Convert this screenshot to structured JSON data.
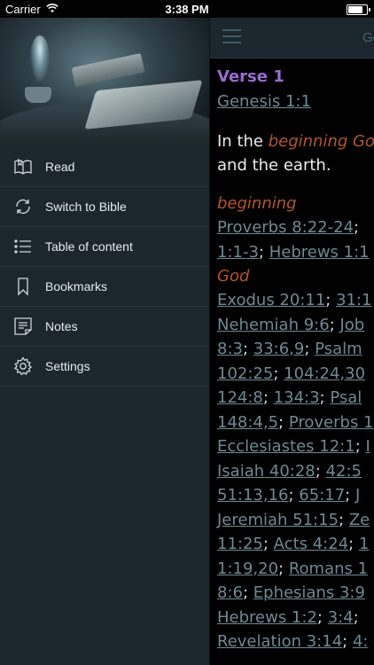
{
  "status_bar": {
    "carrier": "Carrier",
    "time": "3:38 PM"
  },
  "sidebar": {
    "items": [
      {
        "label": "Read",
        "icon": "open-book-icon"
      },
      {
        "label": "Switch to Bible",
        "icon": "refresh-icon"
      },
      {
        "label": "Table of content",
        "icon": "list-icon"
      },
      {
        "label": "Bookmarks",
        "icon": "bookmark-icon"
      },
      {
        "label": "Notes",
        "icon": "note-icon"
      },
      {
        "label": "Settings",
        "icon": "gear-icon"
      }
    ]
  },
  "reader": {
    "header_title": "Gen",
    "verse_heading": "Verse 1",
    "verse_ref": "Genesis 1:1",
    "verse_text_plain": "In the ",
    "verse_text_emph": "beginning God",
    "verse_text_line2": "and the earth.",
    "xref_blocks": [
      {
        "term": "beginning",
        "lines": [
          [
            "Proverbs 8:22-24",
            "; "
          ],
          [
            "1:1-3",
            "; ",
            "Hebrews 1:1"
          ]
        ]
      },
      {
        "term": "God",
        "lines": [
          [
            "Exodus 20:11",
            "; ",
            "31:1"
          ],
          [
            "Nehemiah 9:6",
            "; ",
            "Job"
          ],
          [
            "8:3",
            "; ",
            "33:6,9",
            "; ",
            "Psalm"
          ],
          [
            "102:25",
            "; ",
            "104:24,30"
          ],
          [
            "124:8",
            "; ",
            "134:3",
            "; ",
            "Psal"
          ],
          [
            "148:4,5",
            "; ",
            "Proverbs 1"
          ],
          [
            "Ecclesiastes 12:1",
            "; ",
            "I"
          ],
          [
            "Isaiah 40:28",
            "; ",
            "42:5"
          ],
          [
            "51:13,16",
            "; ",
            "65:17",
            "; ",
            "J"
          ],
          [
            "Jeremiah 51:15",
            "; ",
            "Ze"
          ],
          [
            "11:25",
            "; ",
            "Acts 4:24",
            "; ",
            "1"
          ],
          [
            "1:19,20",
            "; ",
            "Romans 1"
          ],
          [
            "8:6",
            "; ",
            "Ephesians 3:9"
          ],
          [
            "Hebrews 1:2",
            "; ",
            "3:4",
            "; "
          ],
          [
            "Revelation 3:14",
            "; ",
            "4:"
          ]
        ]
      }
    ]
  }
}
